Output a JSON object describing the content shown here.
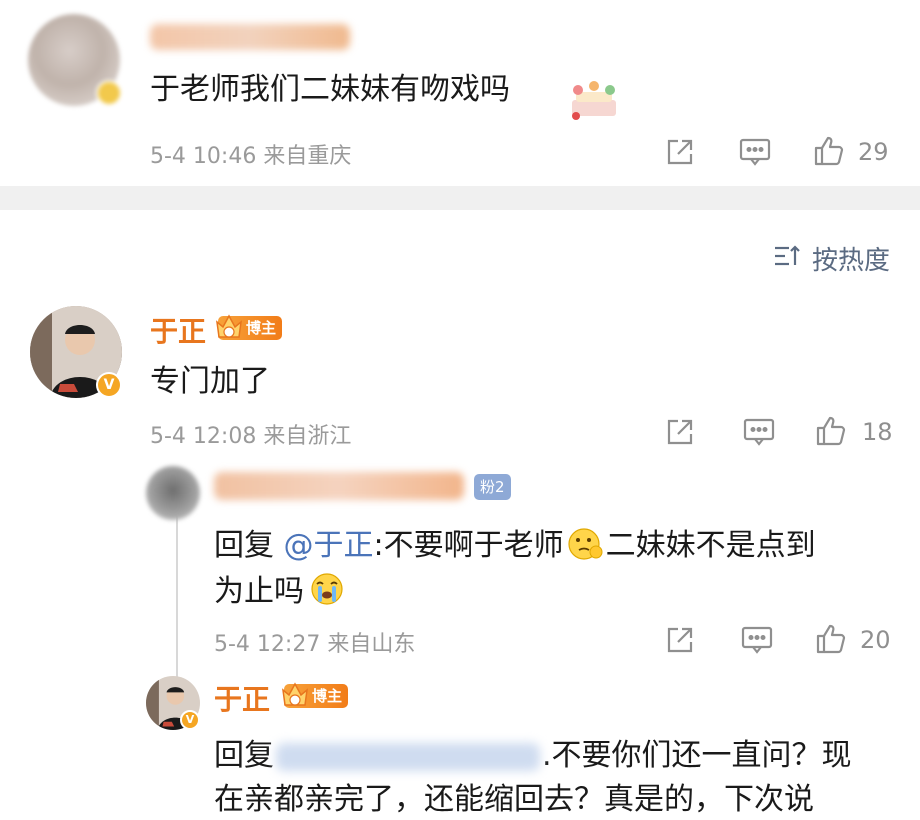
{
  "comment1": {
    "text": "于老师我们二妹妹有吻戏吗",
    "meta": "5-4 10:46  来自重庆",
    "likes": "29"
  },
  "sort": {
    "label": "按热度"
  },
  "comment2": {
    "name": "于正",
    "badge": "博主",
    "text": "专门加了",
    "meta": "5-4 12:08  来自浙江",
    "likes": "18"
  },
  "reply1": {
    "fan_badge": "粉2",
    "prefix": "回复 ",
    "mention": "@于正",
    "text_line1": ":不要啊于老师",
    "text_line1b": "二妹妹不是点到",
    "text_line2": "为止吗",
    "meta": "5-4 12:27  来自山东",
    "likes": "20"
  },
  "reply2": {
    "name": "于正",
    "badge": "博主",
    "prefix": "回复",
    "text_line1": ".不要你们还一直问？现",
    "text_line2": "在亲都亲完了，还能缩回去？真是的，下次说"
  },
  "colors": {
    "name_orange": "#e8761e",
    "mention_blue": "#4b74b9",
    "meta_gray": "#9a9a9a",
    "divider": "#f0f0f0"
  }
}
